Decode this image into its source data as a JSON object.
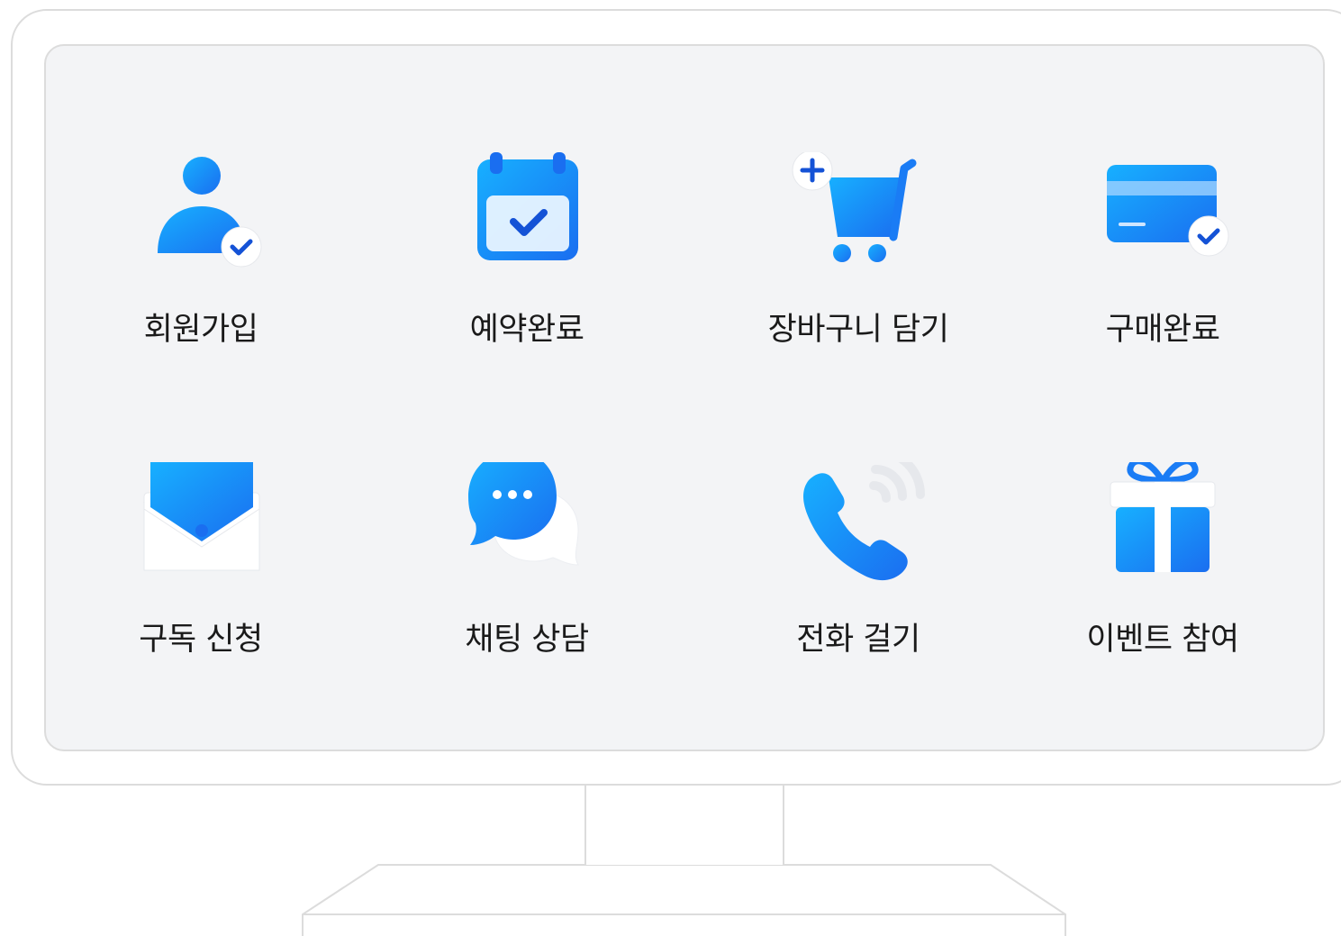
{
  "colors": {
    "accent": "#1a7cf5",
    "accent_light": "#17b0ff",
    "check": "#1452d6",
    "screen_bg": "#f3f4f6",
    "frame_border": "#dcdcdc"
  },
  "grid": {
    "row1": [
      {
        "icon": "user-check-icon",
        "label": "회원가입"
      },
      {
        "icon": "calendar-check-icon",
        "label": "예약완료"
      },
      {
        "icon": "cart-add-icon",
        "label": "장바구니 담기"
      },
      {
        "icon": "card-check-icon",
        "label": "구매완료"
      }
    ],
    "row2": [
      {
        "icon": "envelope-icon",
        "label": "구독 신청"
      },
      {
        "icon": "chat-bubbles-icon",
        "label": "채팅 상담"
      },
      {
        "icon": "phone-call-icon",
        "label": "전화 걸기"
      },
      {
        "icon": "gift-icon",
        "label": "이벤트 참여"
      }
    ]
  }
}
